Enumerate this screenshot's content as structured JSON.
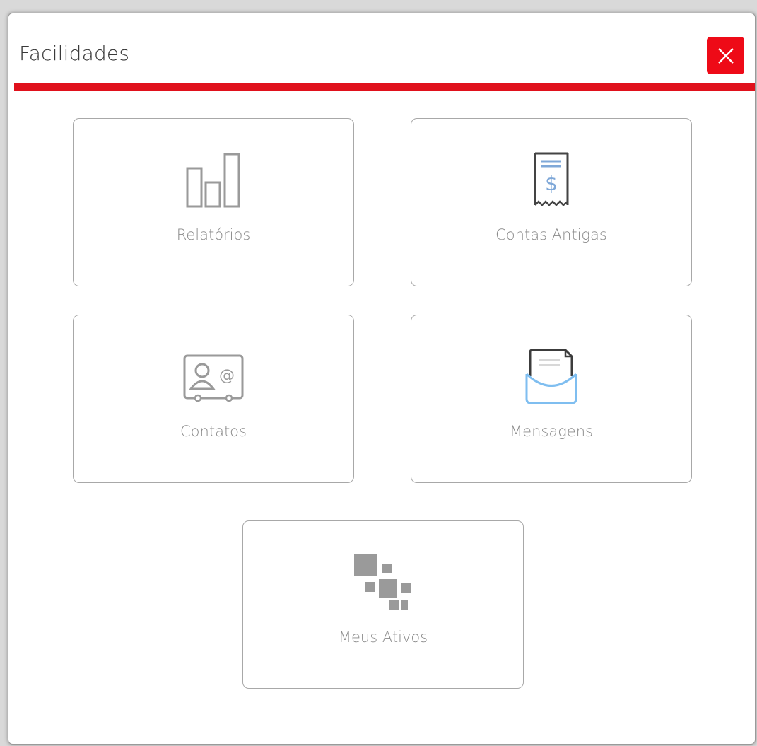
{
  "dialog": {
    "title": "Facilidades",
    "close_icon": "close-icon",
    "accent_color": "#e0111c"
  },
  "tiles": [
    {
      "label": "Relatórios",
      "icon": "bar-chart-icon"
    },
    {
      "label": "Contas Antigas",
      "icon": "receipt-icon"
    },
    {
      "label": "Contatos",
      "icon": "contact-card-icon"
    },
    {
      "label": "Mensagens",
      "icon": "envelope-icon"
    },
    {
      "label": "Meus Ativos",
      "icon": "pixel-blocks-icon"
    }
  ]
}
